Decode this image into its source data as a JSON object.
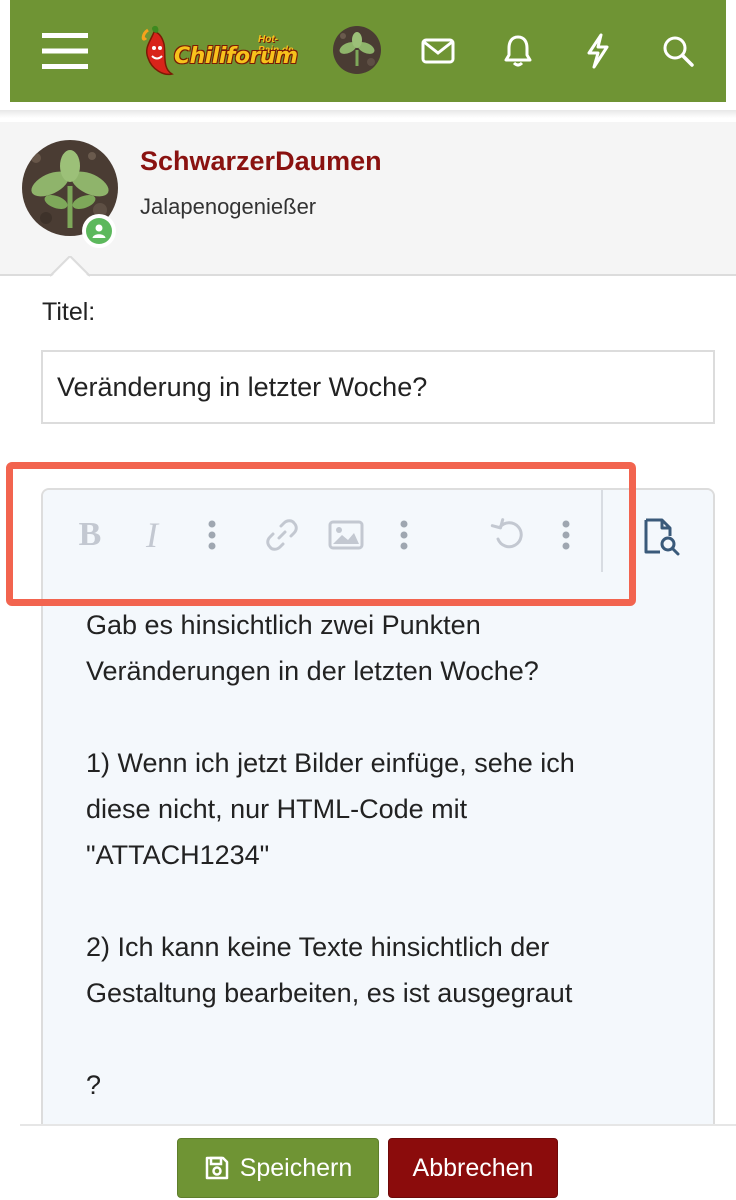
{
  "nav": {
    "logo_text": "Chiliforum",
    "logo_sub": "Hot-Pain.de"
  },
  "user": {
    "name": "SchwarzerDaumen",
    "title": "Jalapenogenießer"
  },
  "form": {
    "title_label": "Titel:",
    "title_value": "Veränderung in letzter Woche?"
  },
  "editor": {
    "toolbar": {
      "bold_label": "B",
      "italic_label": "I"
    },
    "content": "Gab es hinsichtlich zwei Punkten\nVeränderungen in der letzten Woche?\n\n1) Wenn ich jetzt Bilder einfüge, sehe ich\ndiese nicht, nur HTML-Code mit\n\"ATTACH1234\"\n\n2) Ich kann keine Texte hinsichtlich der\nGestaltung bearbeiten, es ist ausgegraut\n\n?"
  },
  "actions": {
    "save_label": "Speichern",
    "cancel_label": "Abbrechen"
  },
  "colors": {
    "brand_green": "#6f9434",
    "username_red": "#8a1210",
    "cancel_red": "#8b0c0c",
    "highlight": "#f2644f",
    "online_green": "#5cb85c"
  }
}
